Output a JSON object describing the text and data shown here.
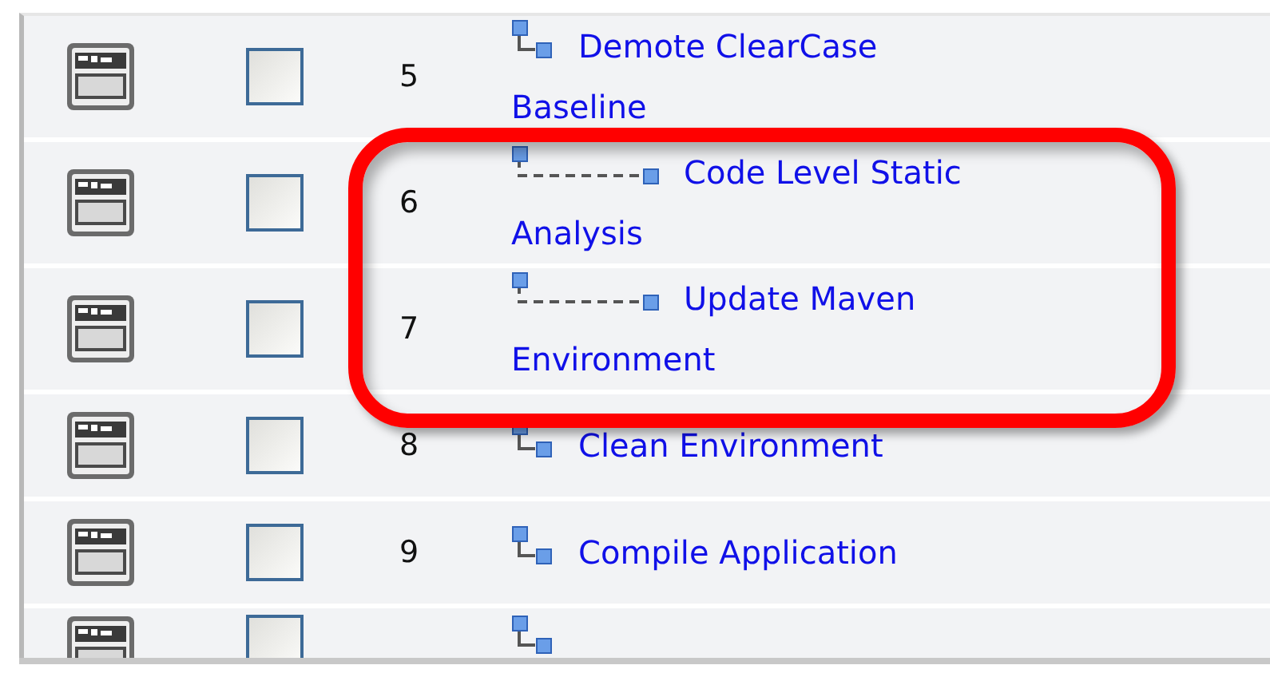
{
  "steps": [
    {
      "number": "5",
      "checked": false,
      "name": "Demote ClearCase Baseline",
      "children": [
        {
          "number": "6",
          "checked": false,
          "name": "Code Level Static Analysis"
        },
        {
          "number": "7",
          "checked": false,
          "name": "Update Maven Environment"
        }
      ]
    },
    {
      "number": "8",
      "checked": false,
      "name": "Clean Environment"
    },
    {
      "number": "9",
      "checked": false,
      "name": "Compile Application"
    },
    {
      "checked": false
    }
  ],
  "annotation": {
    "kind": "rounded-rect",
    "color": "#ff0000"
  }
}
